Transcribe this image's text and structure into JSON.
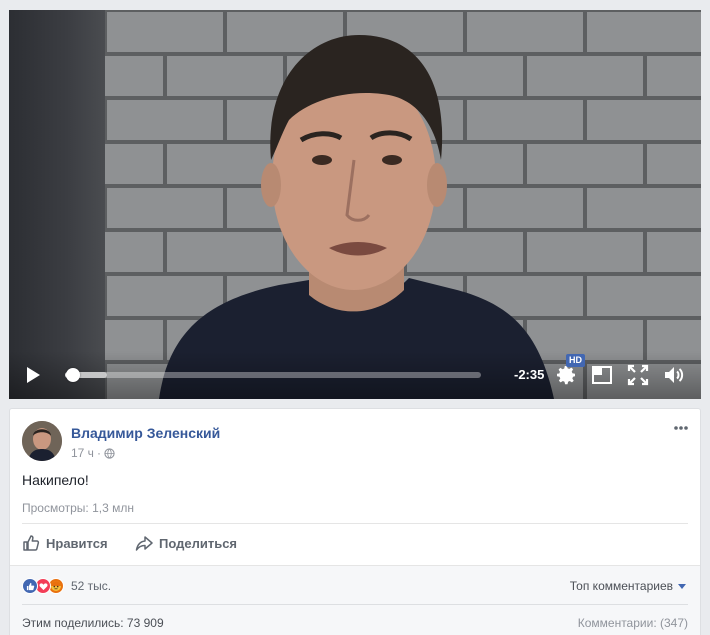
{
  "video": {
    "time_remaining": "-2:35",
    "hd_label": "HD",
    "progress_fraction": 0.02,
    "buffered_fraction": 0.1
  },
  "post": {
    "author": "Владимир Зеленский",
    "time": "17 ч",
    "separator": "·",
    "text": "Накипело!",
    "views": "Просмотры: 1,3 млн"
  },
  "actions": {
    "like_label": "Нравится",
    "share_label": "Поделиться"
  },
  "footer": {
    "reactions_count": "52 тыс.",
    "top_comments_label": "Топ комментариев",
    "shares": "Этим поделились: 73 909",
    "comments": "Комментарии: (347)"
  },
  "icons": {
    "play": "play-icon",
    "settings": "gear-icon",
    "theater": "theater-mode-icon",
    "fullscreen": "fullscreen-icon",
    "volume": "volume-icon",
    "globe": "globe-icon",
    "more": "more-dots-icon",
    "like": "thumbs-up-icon",
    "share": "share-arrow-icon"
  },
  "colors": {
    "link": "#365899",
    "like_reaction": "#4267b2",
    "love_reaction": "#f33e58",
    "angry_reaction": "#e9710f",
    "hd_badge": "#4267b2"
  }
}
